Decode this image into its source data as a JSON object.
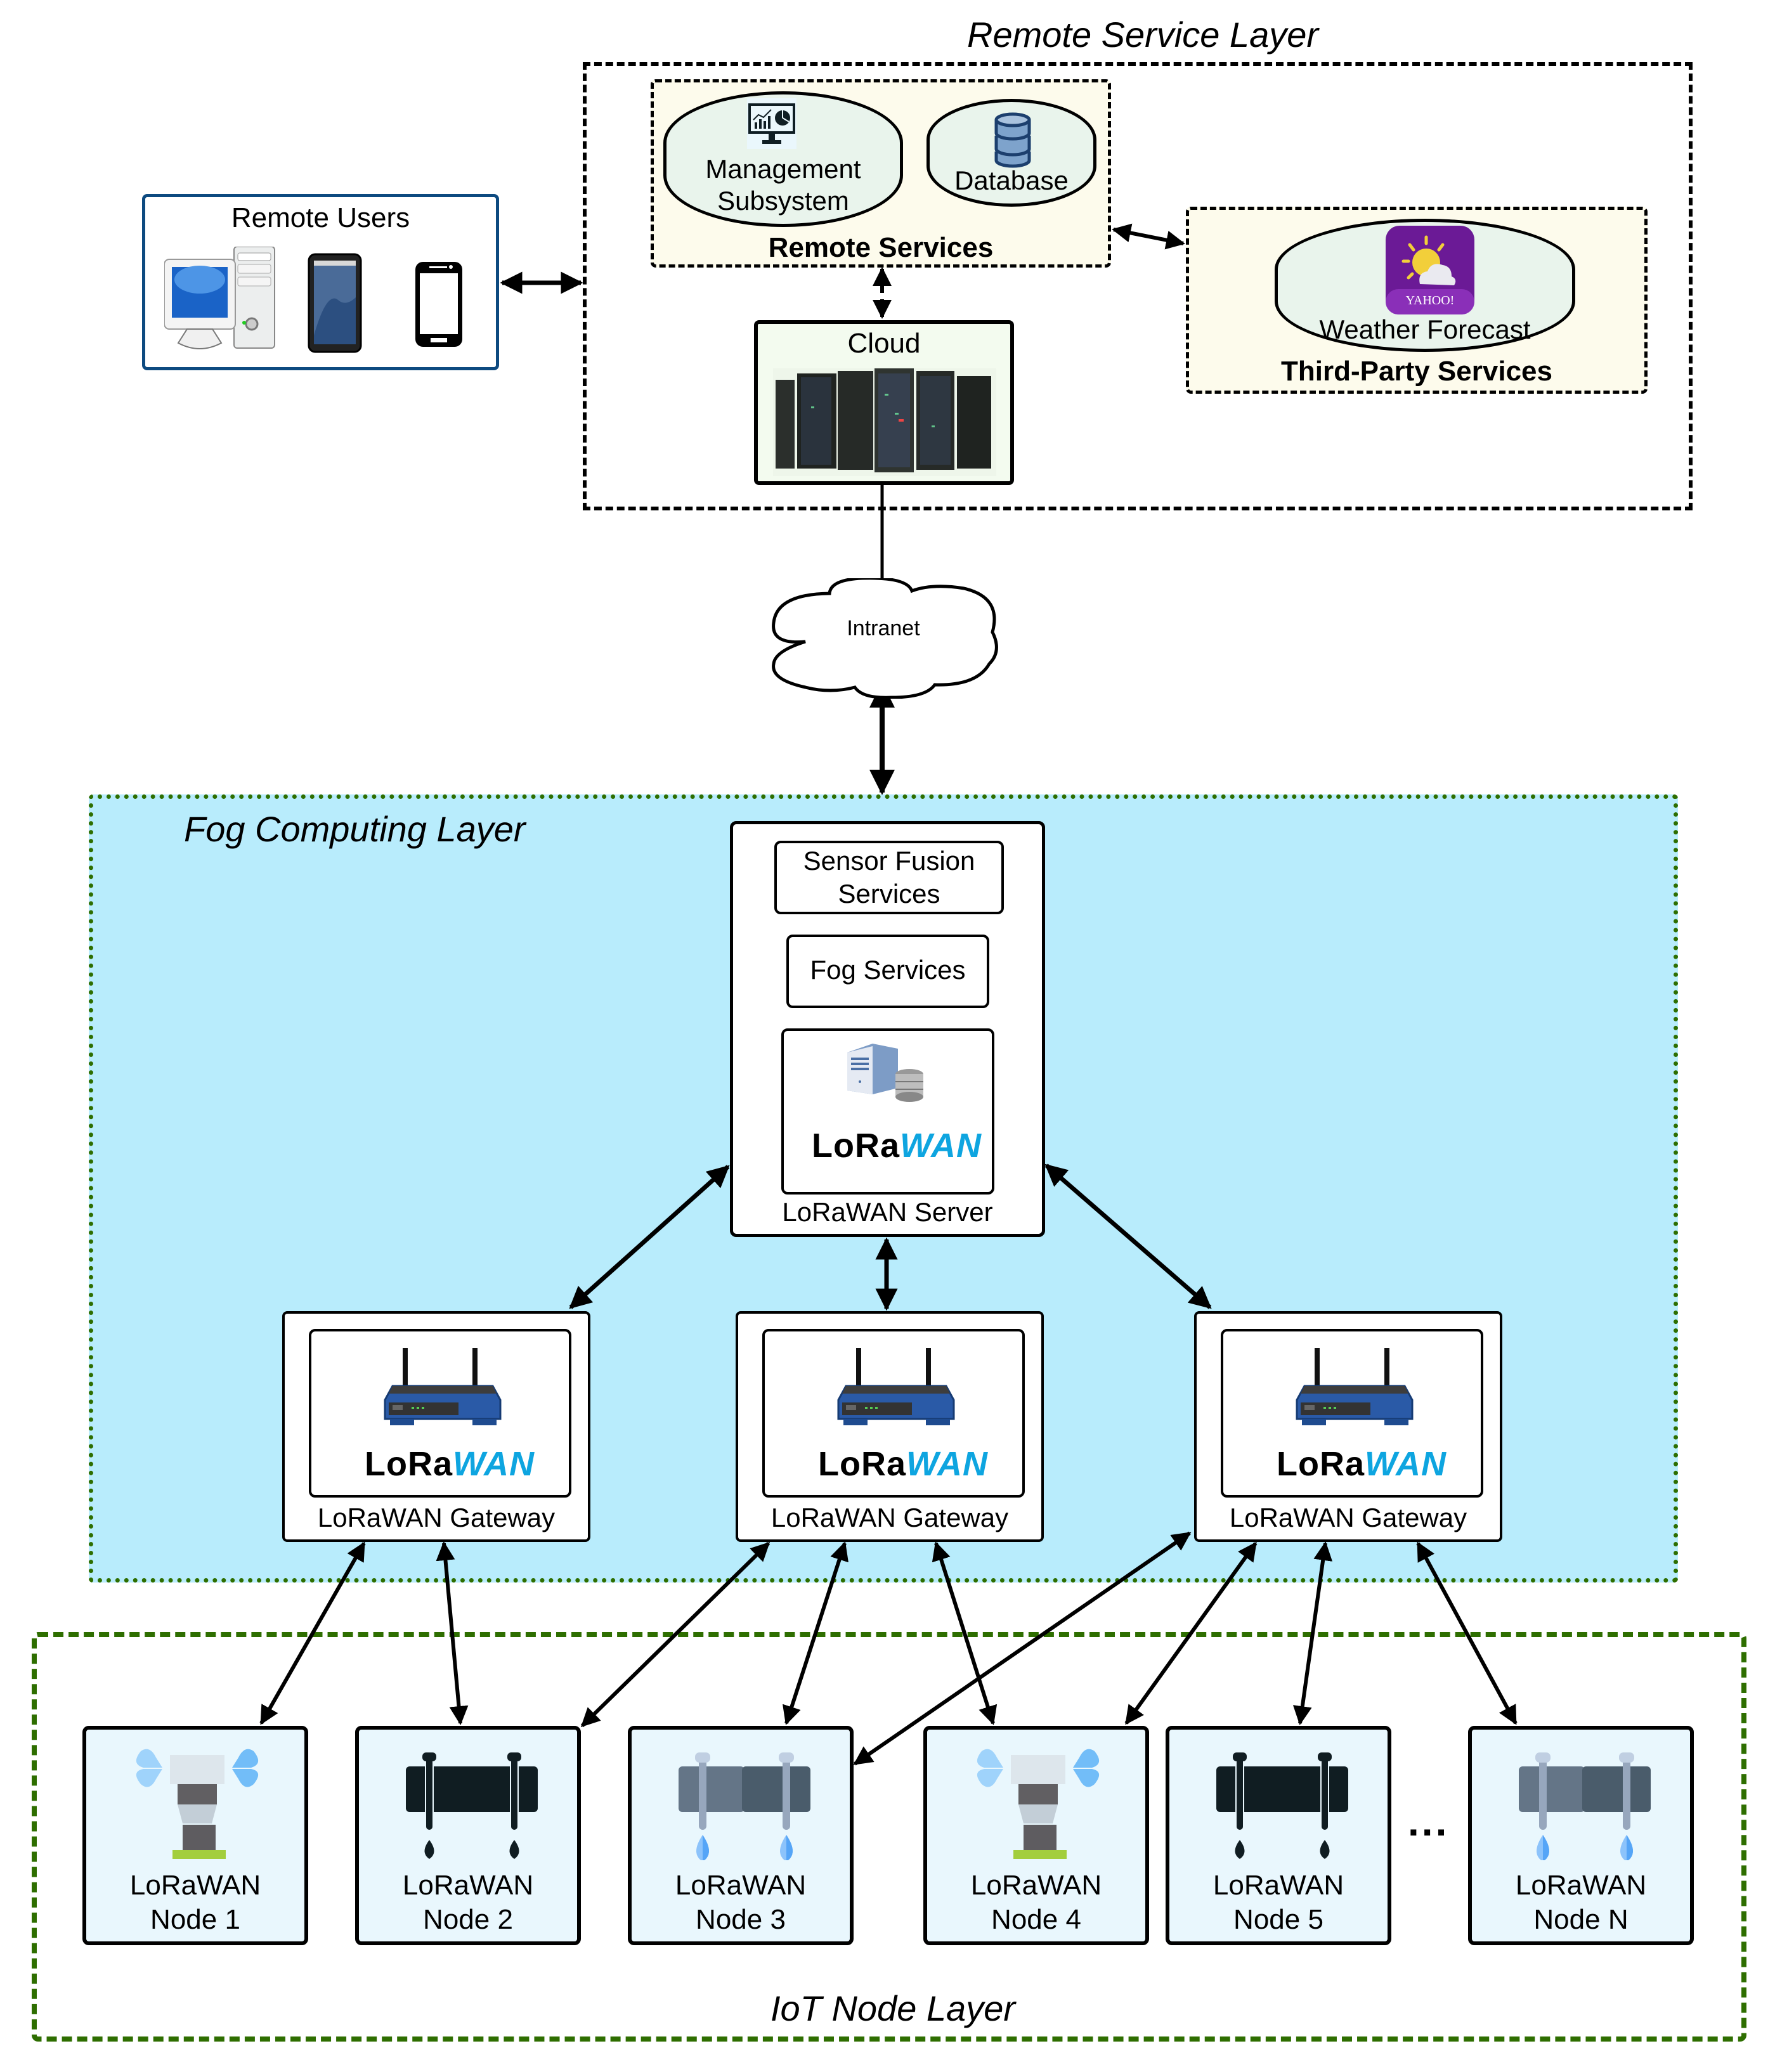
{
  "layers": {
    "remote_service": "Remote Service Layer",
    "fog_computing": "Fog Computing Layer",
    "iot_node": "IoT Node Layer"
  },
  "remote_users": {
    "title": "Remote Users",
    "devices": [
      "desktop-computer",
      "tablet",
      "smartphone"
    ]
  },
  "remote_services": {
    "title": "Remote Services",
    "management": "Management\nSubsystem",
    "management_line1": "Management",
    "management_line2": "Subsystem",
    "database": "Database"
  },
  "third_party": {
    "title": "Third-Party Services",
    "weather": "Weather Forecast",
    "provider_logo": "YAHOO!"
  },
  "cloud": {
    "title": "Cloud"
  },
  "intranet": {
    "label": "Intranet"
  },
  "fog_server": {
    "sensor_fusion_line1": "Sensor Fusion",
    "sensor_fusion_line2": "Services",
    "fog_services": "Fog Services",
    "server_label": "LoRaWAN Server",
    "logo_lora": "LoRa",
    "logo_wan": "WAN"
  },
  "gateways": [
    {
      "label": "LoRaWAN Gateway"
    },
    {
      "label": "LoRaWAN Gateway"
    },
    {
      "label": "LoRaWAN Gateway"
    }
  ],
  "logo": {
    "lora": "LoRa",
    "wan": "WAN",
    "registered": "®"
  },
  "nodes": [
    {
      "line1": "LoRaWAN",
      "line2": "Node 1",
      "icon": "sprinkler"
    },
    {
      "line1": "LoRaWAN",
      "line2": "Node 2",
      "icon": "drip-pipe-dark"
    },
    {
      "line1": "LoRaWAN",
      "line2": "Node 3",
      "icon": "drip-pipe-color"
    },
    {
      "line1": "LoRaWAN",
      "line2": "Node 4",
      "icon": "sprinkler"
    },
    {
      "line1": "LoRaWAN",
      "line2": "Node 5",
      "icon": "drip-pipe-dark"
    },
    {
      "line1": "LoRaWAN",
      "line2": "Node N",
      "icon": "drip-pipe-color"
    }
  ],
  "ellipsis": "...",
  "colors": {
    "fog_bg": "#b8ecfc",
    "layer_border_green": "#2e6e00",
    "service_bg": "#fdfbec",
    "pill_bg": "#e9f4ec",
    "node_bg": "#e9f7fd",
    "users_border": "#0d4a80",
    "lorawan_blue": "#0ea5e0"
  }
}
